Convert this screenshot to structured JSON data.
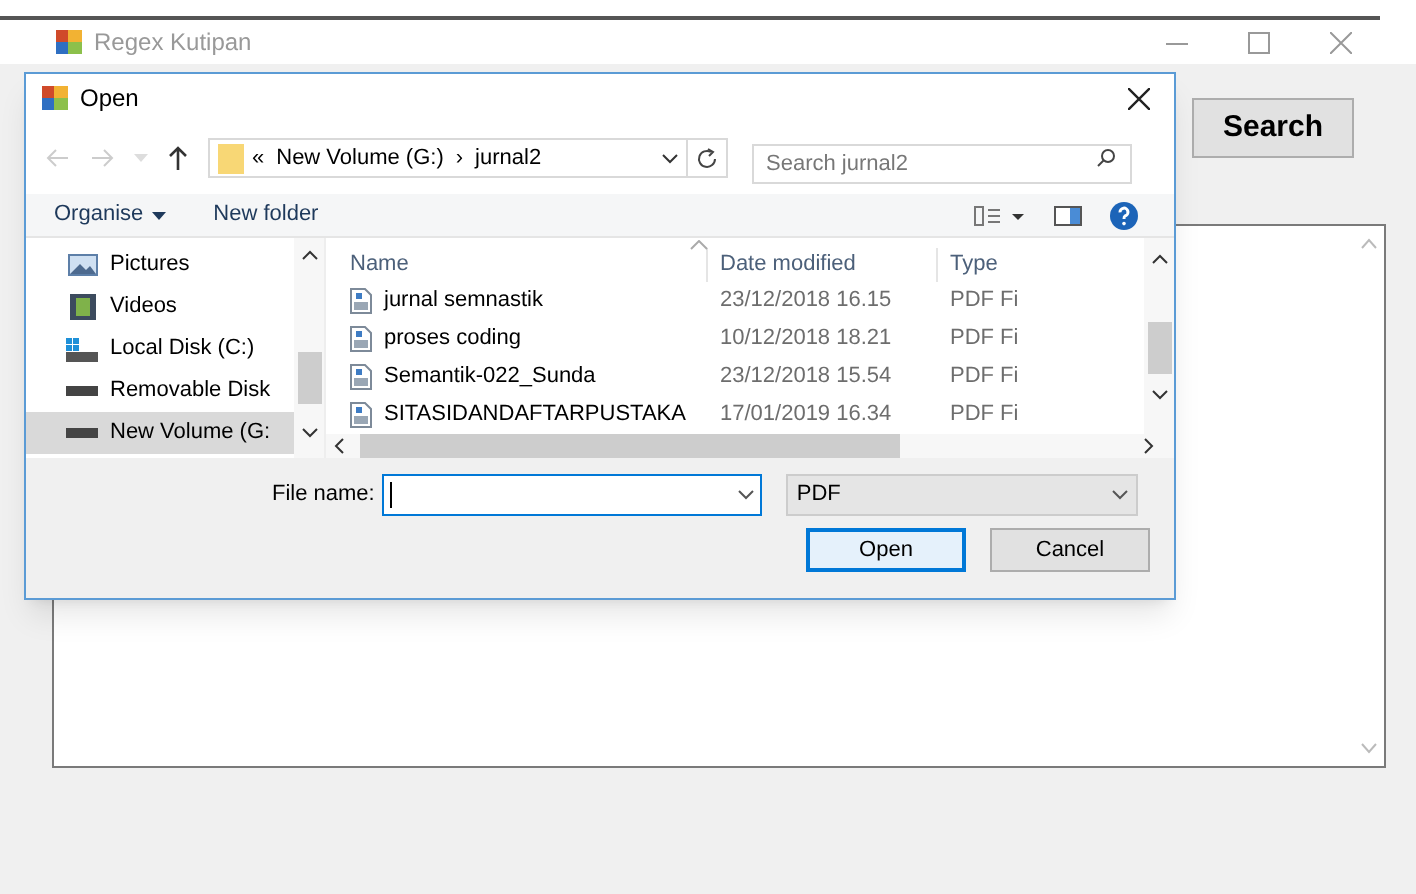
{
  "window": {
    "title": "Regex Kutipan"
  },
  "search_button": "Search",
  "dialog": {
    "title": "Open",
    "address": {
      "overflow": "«",
      "path": [
        {
          "label": "New Volume (G:)"
        },
        {
          "label": "jurnal2"
        }
      ],
      "separator": "›"
    },
    "search": {
      "placeholder": "Search jurnal2"
    },
    "toolbar": {
      "organise": "Organise",
      "new_folder": "New folder"
    },
    "nav_pane": [
      {
        "label": "Pictures",
        "kind": "pictures",
        "selected": false
      },
      {
        "label": "Videos",
        "kind": "videos",
        "selected": false
      },
      {
        "label": "Local Disk (C:)",
        "kind": "system-disk",
        "selected": false
      },
      {
        "label": "Removable Disk",
        "kind": "drive",
        "selected": false
      },
      {
        "label": "New Volume (G:",
        "kind": "drive",
        "selected": true
      }
    ],
    "columns": [
      "Name",
      "Date modified",
      "Type"
    ],
    "files": [
      {
        "name": "jurnal semnastik",
        "date": "23/12/2018 16.15",
        "type": "PDF Fi"
      },
      {
        "name": "proses coding",
        "date": "10/12/2018 18.21",
        "type": "PDF Fi"
      },
      {
        "name": "Semantik-022_Sunda",
        "date": "23/12/2018 15.54",
        "type": "PDF Fi"
      },
      {
        "name": "SITASIDANDAFTARPUSTAKA",
        "date": "17/01/2019 16.34",
        "type": "PDF Fi"
      }
    ],
    "file_name": {
      "label": "File name:"
    },
    "file_type": "PDF",
    "buttons": [
      {
        "label": "Open",
        "kind": "default"
      },
      {
        "label": "Cancel",
        "kind": "normal"
      }
    ]
  }
}
